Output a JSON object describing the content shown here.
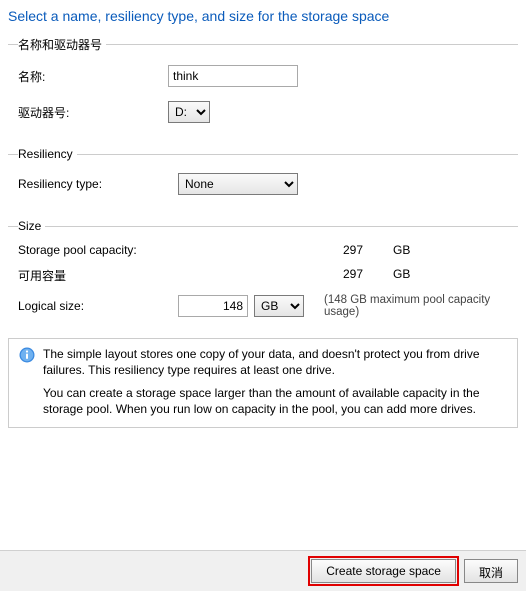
{
  "title": "Select a name, resiliency type, and size for the storage space",
  "nameGroup": {
    "legend": "名称和驱动器号",
    "nameLabel": "名称:",
    "nameValue": "think",
    "driveLabel": "驱动器号:",
    "driveValue": "D:"
  },
  "resiliencyGroup": {
    "legend": "Resiliency",
    "typeLabel": "Resiliency type:",
    "typeValue": "None"
  },
  "sizeGroup": {
    "legend": "Size",
    "poolLabel": "Storage pool capacity:",
    "poolValue": "297",
    "poolUnit": "GB",
    "availLabel": "可用容量",
    "availValue": "297",
    "availUnit": "GB",
    "logicalLabel": "Logical size:",
    "logicalValue": "148",
    "logicalUnit": "GB",
    "logicalNote": "(148 GB maximum pool capacity usage)"
  },
  "info": {
    "p1": "The simple layout stores one copy of your data, and doesn't protect you from drive failures. This resiliency type requires at least one drive.",
    "p2": "You can create a storage space larger than the amount of available capacity in the storage pool. When you run low on capacity in the pool, you can add more drives."
  },
  "buttons": {
    "create": "Create storage space",
    "cancel": "取消"
  }
}
